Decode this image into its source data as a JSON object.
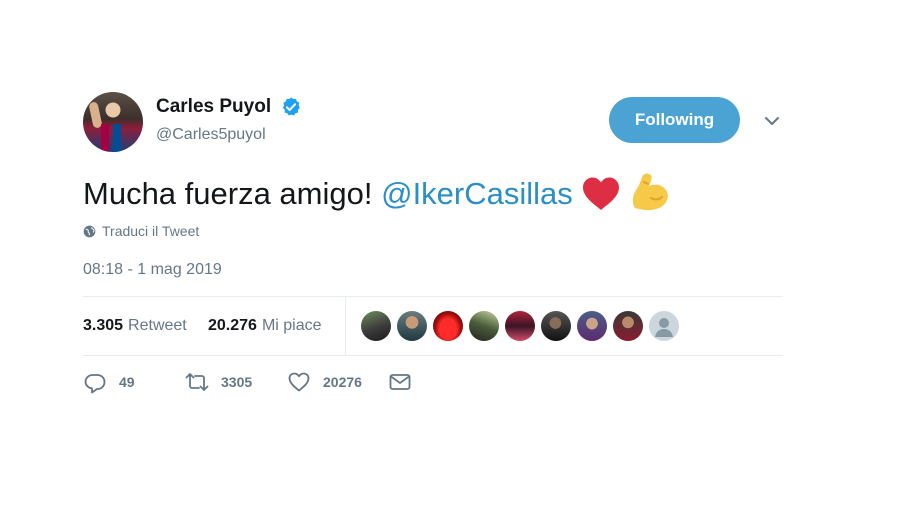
{
  "tweet": {
    "author": {
      "display_name": "Carles Puyol",
      "handle": "@Carles5puyol",
      "verified": true
    },
    "follow_button_label": "Following",
    "text_prefix": "Mucha fuerza amigo! ",
    "mention": "@IkerCasillas",
    "emojis": [
      "red-heart",
      "flexed-biceps"
    ],
    "translate_label": "Traduci il Tweet",
    "timestamp": "08:18 - 1 mag 2019",
    "stats": {
      "retweets_count": "3.305",
      "retweets_label": "Retweet",
      "likes_count": "20.276",
      "likes_label": "Mi piace"
    },
    "actions": {
      "replies": "49",
      "retweets": "3305",
      "likes": "20276"
    }
  },
  "colors": {
    "follow_button": "#4aa3d3",
    "mention": "#2b8fc5",
    "muted": "#657786",
    "verified": "#1da1f2"
  }
}
